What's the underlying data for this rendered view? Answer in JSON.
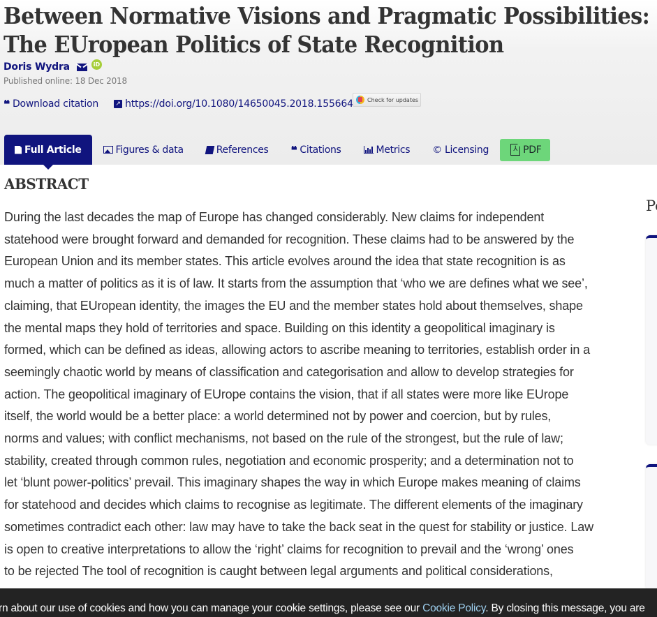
{
  "article": {
    "title_line1": "Between Normative Visions and Pragmatic Possibilities:",
    "title_line2": "The EUropean Politics of State Recognition",
    "author": "Doris Wydra",
    "orcid_label": "iD",
    "published": "Published online: 18 Dec 2018",
    "download_citation": "Download citation",
    "doi": "https://doi.org/10.1080/14650045.2018.1556643",
    "check_updates": "Check for updates"
  },
  "tabs": [
    {
      "label": "Full Article",
      "icon": "document-icon",
      "active": true
    },
    {
      "label": "Figures & data",
      "icon": "image-icon",
      "active": false
    },
    {
      "label": "References",
      "icon": "book-icon",
      "active": false
    },
    {
      "label": "Citations",
      "icon": "quote-icon",
      "active": false
    },
    {
      "label": "Metrics",
      "icon": "bar-chart-icon",
      "active": false
    },
    {
      "label": "Licensing",
      "icon": "copyright-icon",
      "active": false
    },
    {
      "label": "PDF",
      "icon": "pdf-icon",
      "active": false
    }
  ],
  "abstract": {
    "heading": "ABSTRACT",
    "lines": [
      "During the last decades the map of Europe has changed considerably. New claims for independent",
      "statehood were brought forward and demanded for recognition. These claims had to be answered by the",
      "European Union and its member states. This article evolves around the idea that state recognition is as",
      "much a matter of politics as it is of law. It starts from the assumption that ‘who we are defines what we see’,",
      "claiming, that EUropean identity, the images the EU and the member states hold about themselves, shape",
      "the mental maps they hold of territories and space. Building on this identity a geopolitical imaginary is",
      "formed, which can be defined as ideas, allowing actors to ascribe meaning to territories, establish order in a",
      "seemingly chaotic world by means of classification and categorisation and allow to develop strategies for",
      "action. The geopolitical imaginary of EUrope contains the vision, that if all states were more like EUrope",
      "itself, the world would be a better place: a world determined not by power and coercion, but by rules,",
      "norms and values; with conflict mechanisms, not based on the rule of the strongest, but the rule of law;",
      "stability, created through common rules, negotiation and economic prosperity; and a determination not to",
      "let ‘blunt power-politics’ prevail. This imaginary shapes the way in which Europe makes meaning of claims",
      "for statehood and decides which claims to recognise as legitimate. The different elements of the imaginary",
      "sometimes contradict each other: law may have to take the back seat in the quest for stability or justice. Law",
      "is open to creative interpretations to allow the ‘right’ claims for recognition to prevail and the ‘wrong’ ones",
      "to be rejected The tool of recognition is caught between legal arguments and political considerations,"
    ]
  },
  "sidebar": {
    "heading_partial": "Pe"
  },
  "cookie_banner": {
    "text_before": "rn about our use of cookies and how you can manage your cookie settings, please see our ",
    "link": "Cookie Policy",
    "text_after": ". By closing this message, you are"
  },
  "colors": {
    "brand": "#10147e",
    "pdf_button": "#6dd67a",
    "orcid": "#a6ce39",
    "cookie_bg": "#232323",
    "cookie_link": "#9ecfee"
  }
}
